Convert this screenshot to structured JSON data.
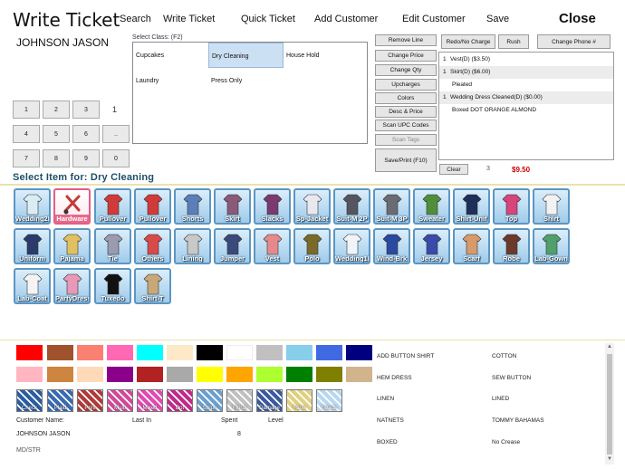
{
  "header": {
    "title": "Write Ticket",
    "menu": [
      "Search",
      "Write Ticket",
      "Quick Ticket",
      "Add Customer",
      "Edit Customer",
      "Save"
    ],
    "close_label": "Close"
  },
  "customer": {
    "name": "JOHNSON JASON"
  },
  "class_selector": {
    "label": "Select Class: (F2)",
    "classes": [
      "Cupcakes",
      "Dry Cleaning",
      "House Hold",
      "Laundry",
      "Press Only"
    ],
    "selected": "Dry Cleaning"
  },
  "keypad": {
    "keys": [
      "1",
      "2",
      "3",
      "4",
      "5",
      "6",
      "..",
      "7",
      "8",
      "9",
      "0"
    ],
    "display": "1"
  },
  "actions": {
    "left": [
      "Remove Line",
      "Change Price",
      "Change Qty",
      "Upcharges",
      "Colors",
      "Desc & Price",
      "Scan UPC Codes",
      "Scan Tags",
      "Save/Print (F10)"
    ],
    "top": [
      "Redo/No Charge",
      "Rush",
      "Change Phone #"
    ]
  },
  "ticket": {
    "lines": [
      {
        "qty": "1",
        "text": "Vest(D)   ($3.50)"
      },
      {
        "qty": "1",
        "text": "Skirt(D)   ($6.00)"
      },
      {
        "qty": "",
        "text": "Pleated"
      },
      {
        "qty": "1",
        "text": "Wedding Dress Cleaned(D)   ($0.00)"
      },
      {
        "qty": "",
        "text": "Boxed DOT ORANGE ALMOND"
      }
    ],
    "clear_label": "Clear",
    "count": "3",
    "total": "$9.50"
  },
  "items": {
    "heading": "Select Item for: Dry Cleaning",
    "selected": "Hardware",
    "list": [
      {
        "label": "Wedding2P",
        "icon": "wedding-dress-icon",
        "color": "#dcecf4"
      },
      {
        "label": "Hardware",
        "icon": "hardware-tools-icon",
        "color": "#c23b3b"
      },
      {
        "label": "Pullover",
        "icon": "pullover-icon",
        "color": "#d23a3a"
      },
      {
        "label": "Pullover",
        "icon": "pullover-icon",
        "color": "#d23a3a"
      },
      {
        "label": "Shorts",
        "icon": "shorts-icon",
        "color": "#5a7fb8"
      },
      {
        "label": "Skirt",
        "icon": "skirt-icon",
        "color": "#8a5a7a"
      },
      {
        "label": "Slacks",
        "icon": "slacks-icon",
        "color": "#7a3a70"
      },
      {
        "label": "Sp-Jacket",
        "icon": "sport-jacket-icon",
        "color": "#e8e8ee"
      },
      {
        "label": "Suit-M 2P",
        "icon": "suit-two-piece-icon",
        "color": "#555560"
      },
      {
        "label": "Suit-M 3P",
        "icon": "suit-three-piece-icon",
        "color": "#6b6b74"
      },
      {
        "label": "Sweater",
        "icon": "sweater-icon",
        "color": "#4f8f3a"
      },
      {
        "label": "Shirt-Unif",
        "icon": "uniform-shirt-icon",
        "color": "#1f2f5a"
      },
      {
        "label": "Top",
        "icon": "top-icon",
        "color": "#d8457a"
      },
      {
        "label": "Shirt",
        "icon": "shirt-icon",
        "color": "#f2f2f2"
      },
      {
        "label": "Uniform",
        "icon": "uniform-icon",
        "color": "#2a3a6a"
      },
      {
        "label": "Pajama",
        "icon": "pajama-icon",
        "color": "#e0c060"
      },
      {
        "label": "Tie",
        "icon": "tie-icon",
        "color": "#9a9ab0"
      },
      {
        "label": "Others",
        "icon": "others-icon",
        "color": "#d84a4a"
      },
      {
        "label": "Lining",
        "icon": "lining-icon",
        "color": "#c8c8c8"
      },
      {
        "label": "Jumper",
        "icon": "jumper-icon",
        "color": "#3a4a7a"
      },
      {
        "label": "Vest",
        "icon": "vest-icon",
        "color": "#e58a8a"
      },
      {
        "label": "Polo",
        "icon": "polo-icon",
        "color": "#7a6a2a"
      },
      {
        "label": "Wedding1P",
        "icon": "wedding-dress-icon",
        "color": "#eef4f8"
      },
      {
        "label": "Wind-Brk",
        "icon": "windbreaker-icon",
        "color": "#2a4aa0"
      },
      {
        "label": "Jersey",
        "icon": "jersey-icon",
        "color": "#3a4aa8"
      },
      {
        "label": "Scarf",
        "icon": "scarf-icon",
        "color": "#d89a6a"
      },
      {
        "label": "Robe",
        "icon": "robe-icon",
        "color": "#6a3a2a"
      },
      {
        "label": "Lab-Gown",
        "icon": "lab-gown-icon",
        "color": "#4fa06a"
      },
      {
        "label": "Lab-Coat",
        "icon": "lab-coat-icon",
        "color": "#f4f4f4"
      },
      {
        "label": "PartyDress",
        "icon": "party-dress-icon",
        "color": "#e898b8"
      },
      {
        "label": "Tuxedo",
        "icon": "tuxedo-icon",
        "color": "#111111"
      },
      {
        "label": "Shirt-T",
        "icon": "tshirt-icon",
        "color": "#c8a878"
      }
    ]
  },
  "colors": {
    "row1": [
      "#ff0000",
      "#a0522d",
      "#fa8072",
      "#ff69b4",
      "#00ffff",
      "#fde9c8",
      "#000000",
      "#ffffff",
      "#c0c0c0",
      "#87ceeb",
      "#4169e1",
      "#000080"
    ],
    "row2": [
      "#ffb6c1",
      "#cd853f",
      "#ffdab9",
      "#8b008b",
      "#b22222",
      "#a9a9a9",
      "#ffff00",
      "#ffa500",
      "#adff2f",
      "#008000",
      "#808000",
      "#d2b48c"
    ]
  },
  "patterns": [
    {
      "label": "Check",
      "icon": "check-pattern-icon",
      "color": "#2b5da0"
    },
    {
      "label": "Plaid",
      "icon": "plaid-pattern-icon",
      "color": "#3a6ab0"
    },
    {
      "label": "Print",
      "icon": "print-pattern-icon",
      "color": "#b03a3a"
    },
    {
      "label": "Multi",
      "icon": "multi-pattern-icon",
      "color": "#d04a9a"
    },
    {
      "label": "Mixed",
      "icon": "mixed-pattern-icon",
      "color": "#e04ab0"
    },
    {
      "label": "Dot",
      "icon": "dot-pattern-icon",
      "color": "#c02a8a"
    },
    {
      "label": "Stripe",
      "icon": "stripe-pattern-icon",
      "color": "#6aa0d0"
    },
    {
      "label": "Floral",
      "icon": "floral-pattern-icon",
      "color": "#c0c0c0"
    },
    {
      "label": "Damage",
      "icon": "damage-icon",
      "color": "#3a5aa0"
    },
    {
      "label": "Fade",
      "icon": "fade-icon",
      "color": "#e0d080"
    },
    {
      "label": "Beads",
      "icon": "beads-icon",
      "color": "#b8d8f0"
    }
  ],
  "customer_info": {
    "labels": [
      "Customer Name:",
      "Last In",
      "Spent",
      "Level"
    ],
    "name": "JOHNSON JASON",
    "spent": "8",
    "store": "MD/STR"
  },
  "specs": {
    "left": [
      "ADD BUTTON SHIRT",
      "HEM DRESS",
      "LINEN",
      "NATNETS",
      "BOXED"
    ],
    "right": [
      "COTTON",
      "SEW BUTTON",
      "LINED",
      "TOMMY BAHAMAS",
      "No Crease"
    ]
  }
}
